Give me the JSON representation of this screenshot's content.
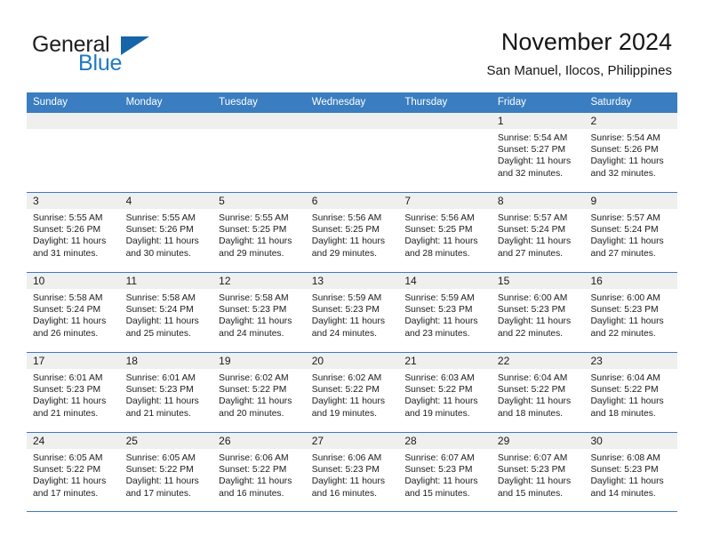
{
  "brand": {
    "word_general": "General",
    "word_blue": "Blue",
    "mark": "triangle-flag"
  },
  "header": {
    "title": "November 2024",
    "subtitle": "San Manuel, Ilocos, Philippines"
  },
  "colors": {
    "header_blue": "#3a7dc0",
    "brand_blue": "#2079c4",
    "mark_blue": "#1565a8",
    "day_band_gray": "#efefef",
    "text": "#1a1a1a"
  },
  "weekdays": [
    "Sunday",
    "Monday",
    "Tuesday",
    "Wednesday",
    "Thursday",
    "Friday",
    "Saturday"
  ],
  "weeks": [
    [
      {
        "day": "",
        "sunrise": "",
        "sunset": "",
        "daylight_1": "",
        "daylight_2": ""
      },
      {
        "day": "",
        "sunrise": "",
        "sunset": "",
        "daylight_1": "",
        "daylight_2": ""
      },
      {
        "day": "",
        "sunrise": "",
        "sunset": "",
        "daylight_1": "",
        "daylight_2": ""
      },
      {
        "day": "",
        "sunrise": "",
        "sunset": "",
        "daylight_1": "",
        "daylight_2": ""
      },
      {
        "day": "",
        "sunrise": "",
        "sunset": "",
        "daylight_1": "",
        "daylight_2": ""
      },
      {
        "day": "1",
        "sunrise": "Sunrise: 5:54 AM",
        "sunset": "Sunset: 5:27 PM",
        "daylight_1": "Daylight: 11 hours",
        "daylight_2": "and 32 minutes."
      },
      {
        "day": "2",
        "sunrise": "Sunrise: 5:54 AM",
        "sunset": "Sunset: 5:26 PM",
        "daylight_1": "Daylight: 11 hours",
        "daylight_2": "and 32 minutes."
      }
    ],
    [
      {
        "day": "3",
        "sunrise": "Sunrise: 5:55 AM",
        "sunset": "Sunset: 5:26 PM",
        "daylight_1": "Daylight: 11 hours",
        "daylight_2": "and 31 minutes."
      },
      {
        "day": "4",
        "sunrise": "Sunrise: 5:55 AM",
        "sunset": "Sunset: 5:26 PM",
        "daylight_1": "Daylight: 11 hours",
        "daylight_2": "and 30 minutes."
      },
      {
        "day": "5",
        "sunrise": "Sunrise: 5:55 AM",
        "sunset": "Sunset: 5:25 PM",
        "daylight_1": "Daylight: 11 hours",
        "daylight_2": "and 29 minutes."
      },
      {
        "day": "6",
        "sunrise": "Sunrise: 5:56 AM",
        "sunset": "Sunset: 5:25 PM",
        "daylight_1": "Daylight: 11 hours",
        "daylight_2": "and 29 minutes."
      },
      {
        "day": "7",
        "sunrise": "Sunrise: 5:56 AM",
        "sunset": "Sunset: 5:25 PM",
        "daylight_1": "Daylight: 11 hours",
        "daylight_2": "and 28 minutes."
      },
      {
        "day": "8",
        "sunrise": "Sunrise: 5:57 AM",
        "sunset": "Sunset: 5:24 PM",
        "daylight_1": "Daylight: 11 hours",
        "daylight_2": "and 27 minutes."
      },
      {
        "day": "9",
        "sunrise": "Sunrise: 5:57 AM",
        "sunset": "Sunset: 5:24 PM",
        "daylight_1": "Daylight: 11 hours",
        "daylight_2": "and 27 minutes."
      }
    ],
    [
      {
        "day": "10",
        "sunrise": "Sunrise: 5:58 AM",
        "sunset": "Sunset: 5:24 PM",
        "daylight_1": "Daylight: 11 hours",
        "daylight_2": "and 26 minutes."
      },
      {
        "day": "11",
        "sunrise": "Sunrise: 5:58 AM",
        "sunset": "Sunset: 5:24 PM",
        "daylight_1": "Daylight: 11 hours",
        "daylight_2": "and 25 minutes."
      },
      {
        "day": "12",
        "sunrise": "Sunrise: 5:58 AM",
        "sunset": "Sunset: 5:23 PM",
        "daylight_1": "Daylight: 11 hours",
        "daylight_2": "and 24 minutes."
      },
      {
        "day": "13",
        "sunrise": "Sunrise: 5:59 AM",
        "sunset": "Sunset: 5:23 PM",
        "daylight_1": "Daylight: 11 hours",
        "daylight_2": "and 24 minutes."
      },
      {
        "day": "14",
        "sunrise": "Sunrise: 5:59 AM",
        "sunset": "Sunset: 5:23 PM",
        "daylight_1": "Daylight: 11 hours",
        "daylight_2": "and 23 minutes."
      },
      {
        "day": "15",
        "sunrise": "Sunrise: 6:00 AM",
        "sunset": "Sunset: 5:23 PM",
        "daylight_1": "Daylight: 11 hours",
        "daylight_2": "and 22 minutes."
      },
      {
        "day": "16",
        "sunrise": "Sunrise: 6:00 AM",
        "sunset": "Sunset: 5:23 PM",
        "daylight_1": "Daylight: 11 hours",
        "daylight_2": "and 22 minutes."
      }
    ],
    [
      {
        "day": "17",
        "sunrise": "Sunrise: 6:01 AM",
        "sunset": "Sunset: 5:23 PM",
        "daylight_1": "Daylight: 11 hours",
        "daylight_2": "and 21 minutes."
      },
      {
        "day": "18",
        "sunrise": "Sunrise: 6:01 AM",
        "sunset": "Sunset: 5:23 PM",
        "daylight_1": "Daylight: 11 hours",
        "daylight_2": "and 21 minutes."
      },
      {
        "day": "19",
        "sunrise": "Sunrise: 6:02 AM",
        "sunset": "Sunset: 5:22 PM",
        "daylight_1": "Daylight: 11 hours",
        "daylight_2": "and 20 minutes."
      },
      {
        "day": "20",
        "sunrise": "Sunrise: 6:02 AM",
        "sunset": "Sunset: 5:22 PM",
        "daylight_1": "Daylight: 11 hours",
        "daylight_2": "and 19 minutes."
      },
      {
        "day": "21",
        "sunrise": "Sunrise: 6:03 AM",
        "sunset": "Sunset: 5:22 PM",
        "daylight_1": "Daylight: 11 hours",
        "daylight_2": "and 19 minutes."
      },
      {
        "day": "22",
        "sunrise": "Sunrise: 6:04 AM",
        "sunset": "Sunset: 5:22 PM",
        "daylight_1": "Daylight: 11 hours",
        "daylight_2": "and 18 minutes."
      },
      {
        "day": "23",
        "sunrise": "Sunrise: 6:04 AM",
        "sunset": "Sunset: 5:22 PM",
        "daylight_1": "Daylight: 11 hours",
        "daylight_2": "and 18 minutes."
      }
    ],
    [
      {
        "day": "24",
        "sunrise": "Sunrise: 6:05 AM",
        "sunset": "Sunset: 5:22 PM",
        "daylight_1": "Daylight: 11 hours",
        "daylight_2": "and 17 minutes."
      },
      {
        "day": "25",
        "sunrise": "Sunrise: 6:05 AM",
        "sunset": "Sunset: 5:22 PM",
        "daylight_1": "Daylight: 11 hours",
        "daylight_2": "and 17 minutes."
      },
      {
        "day": "26",
        "sunrise": "Sunrise: 6:06 AM",
        "sunset": "Sunset: 5:22 PM",
        "daylight_1": "Daylight: 11 hours",
        "daylight_2": "and 16 minutes."
      },
      {
        "day": "27",
        "sunrise": "Sunrise: 6:06 AM",
        "sunset": "Sunset: 5:23 PM",
        "daylight_1": "Daylight: 11 hours",
        "daylight_2": "and 16 minutes."
      },
      {
        "day": "28",
        "sunrise": "Sunrise: 6:07 AM",
        "sunset": "Sunset: 5:23 PM",
        "daylight_1": "Daylight: 11 hours",
        "daylight_2": "and 15 minutes."
      },
      {
        "day": "29",
        "sunrise": "Sunrise: 6:07 AM",
        "sunset": "Sunset: 5:23 PM",
        "daylight_1": "Daylight: 11 hours",
        "daylight_2": "and 15 minutes."
      },
      {
        "day": "30",
        "sunrise": "Sunrise: 6:08 AM",
        "sunset": "Sunset: 5:23 PM",
        "daylight_1": "Daylight: 11 hours",
        "daylight_2": "and 14 minutes."
      }
    ]
  ]
}
